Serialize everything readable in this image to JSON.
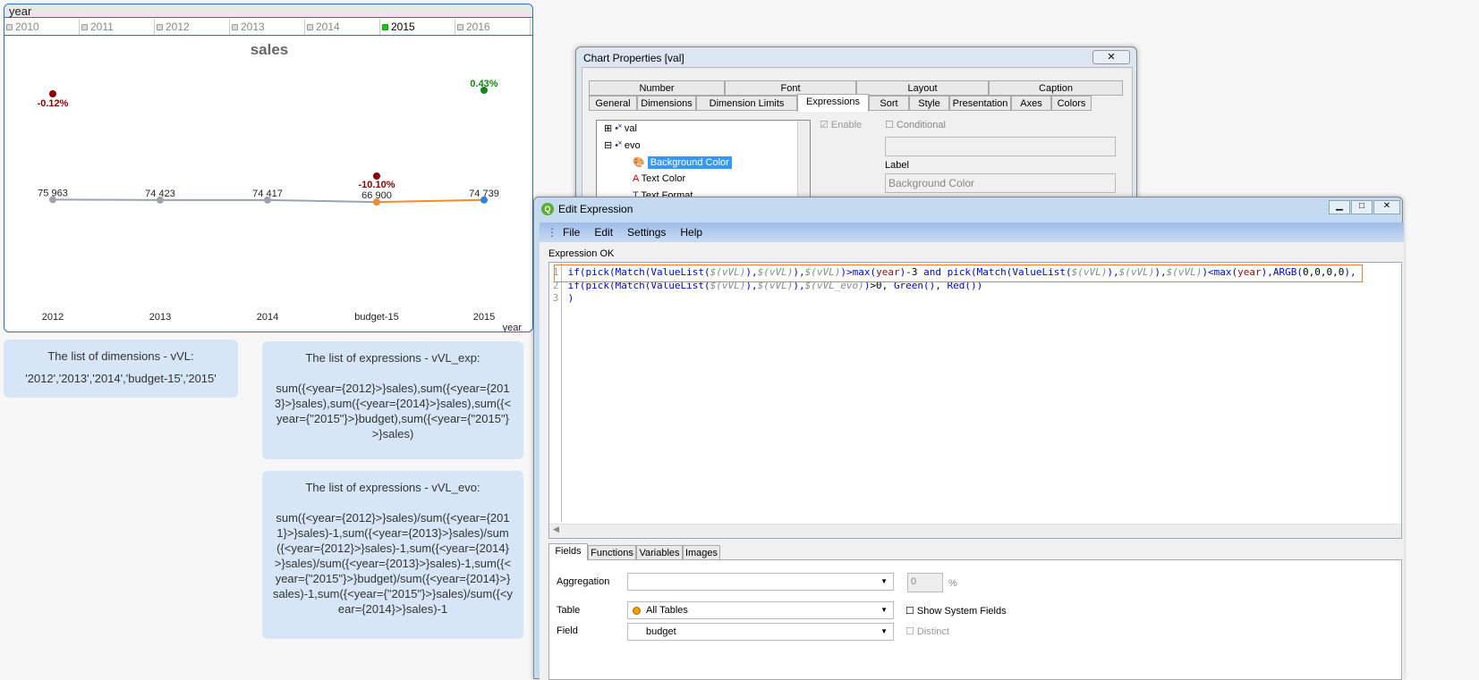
{
  "listbox": {
    "title": "year",
    "items": [
      {
        "label": "2010",
        "selected": false
      },
      {
        "label": "2011",
        "selected": false
      },
      {
        "label": "2012",
        "selected": false
      },
      {
        "label": "2013",
        "selected": false
      },
      {
        "label": "2014",
        "selected": false
      },
      {
        "label": "2015",
        "selected": true
      },
      {
        "label": "2016",
        "selected": false
      }
    ]
  },
  "chart_data": {
    "type": "line",
    "title": "sales",
    "xlabel": "year",
    "categories": [
      "2012",
      "2013",
      "2014",
      "budget-15",
      "2015"
    ],
    "series": [
      {
        "values": [
          75963,
          74423,
          74417,
          66900,
          74739
        ],
        "labels": [
          "75 963",
          "74 423",
          "74 417",
          "66 900",
          "74 739"
        ],
        "point_colors": [
          "#9aa4ae",
          "#9aa4ae",
          "#9aa4ae",
          "#f28a2e",
          "#2f86e0"
        ]
      }
    ],
    "evo": {
      "values": [
        -0.12,
        null,
        null,
        -10.1,
        0.43
      ],
      "labels": [
        "-0.12%",
        "",
        "",
        "-10.10%",
        "0.43%"
      ],
      "colors": [
        "#8b0000",
        "",
        "",
        "#8b0000",
        "#108a10"
      ]
    }
  },
  "notes": [
    {
      "title": "The list of dimensions - vVL:",
      "body": "'2012','2013','2014','budget-15','2015'"
    },
    {
      "title": "The list of expressions - vVL_exp:",
      "body": "sum({<year={2012}>}sales),sum({<year={2013}>}sales),sum({<year={2014}>}sales),sum({<year={\"2015\"}>}budget),sum({<year={\"2015\"}>}sales)"
    },
    {
      "title": "The list of expressions - vVL_evo:",
      "body": "sum({<year={2012}>}sales)/sum({<year={2011}>}sales)-1,sum({<year={2013}>}sales)/sum({<year={2012}>}sales)-1,sum({<year={2014}>}sales)/sum({<year={2013}>}sales)-1,sum({<year={\"2015\"}>}budget)/sum({<year={2014}>}sales)-1,sum({<year={\"2015\"}>}sales)/sum({<year={2014}>}sales)-1"
    }
  ],
  "chart_props": {
    "title": "Chart Properties [val]",
    "tabs_top": [
      "Number",
      "Font",
      "Layout",
      "Caption"
    ],
    "tabs_bottom": [
      "General",
      "Dimensions",
      "Dimension Limits",
      "Expressions",
      "Sort",
      "Style",
      "Presentation",
      "Axes",
      "Colors"
    ],
    "active_tab": "Expressions",
    "tree": [
      {
        "label": "val",
        "expander": "+"
      },
      {
        "label": "evo",
        "expander": "−"
      },
      {
        "label": "Background Color",
        "selected": true
      },
      {
        "label": "Text Color"
      },
      {
        "label": "Text Format"
      }
    ],
    "enable_label": "Enable",
    "conditional_label": "Conditional",
    "label_caption": "Label",
    "label_value": "Background Color"
  },
  "edit_expr": {
    "title": "Edit Expression",
    "menu": [
      "File",
      "Edit",
      "Settings",
      "Help"
    ],
    "status": "Expression OK",
    "lines": [
      [
        [
          "fn",
          "if(pick(Match(ValueList("
        ],
        [
          "vr",
          "$(vVL)"
        ],
        [
          "fn",
          "),"
        ],
        [
          "vr",
          "$(vVL)"
        ],
        [
          "fn",
          "),"
        ],
        [
          "vr",
          "$(vVL)"
        ],
        [
          "fn",
          ")>max("
        ],
        [
          "fd",
          "year"
        ],
        [
          "fn",
          ")"
        ],
        [
          "tx",
          "-3 "
        ],
        [
          "fn",
          "and pick(Match(ValueList("
        ],
        [
          "vr",
          "$(vVL)"
        ],
        [
          "fn",
          "),"
        ],
        [
          "vr",
          "$(vVL)"
        ],
        [
          "fn",
          "),"
        ],
        [
          "vr",
          "$(vVL)"
        ],
        [
          "fn",
          ")<max("
        ],
        [
          "fd",
          "year"
        ],
        [
          "fn",
          "),ARGB("
        ],
        [
          "tx",
          "0,0,0,0"
        ],
        [
          "fn",
          "),"
        ]
      ],
      [
        [
          "fn",
          "if(pick(Match(ValueList("
        ],
        [
          "vr",
          "$(vVL)"
        ],
        [
          "fn",
          "),"
        ],
        [
          "vr",
          "$(vVL)"
        ],
        [
          "fn",
          "),"
        ],
        [
          "vr",
          "$(vVL_evo)"
        ],
        [
          "fn",
          ")"
        ],
        [
          "tx",
          ">0, "
        ],
        [
          "fn",
          "Green(), Red())"
        ]
      ],
      [
        [
          "fn",
          ")"
        ]
      ]
    ],
    "bottom_tabs": [
      "Fields",
      "Functions",
      "Variables",
      "Images"
    ],
    "aggregation_label": "Aggregation",
    "aggregation_value": "",
    "percent_value": "0",
    "percent_unit": "%",
    "table_label": "Table",
    "table_value": "All Tables",
    "show_system_fields": "Show System Fields",
    "field_label": "Field",
    "field_value": "budget",
    "distinct_label": "Distinct"
  }
}
